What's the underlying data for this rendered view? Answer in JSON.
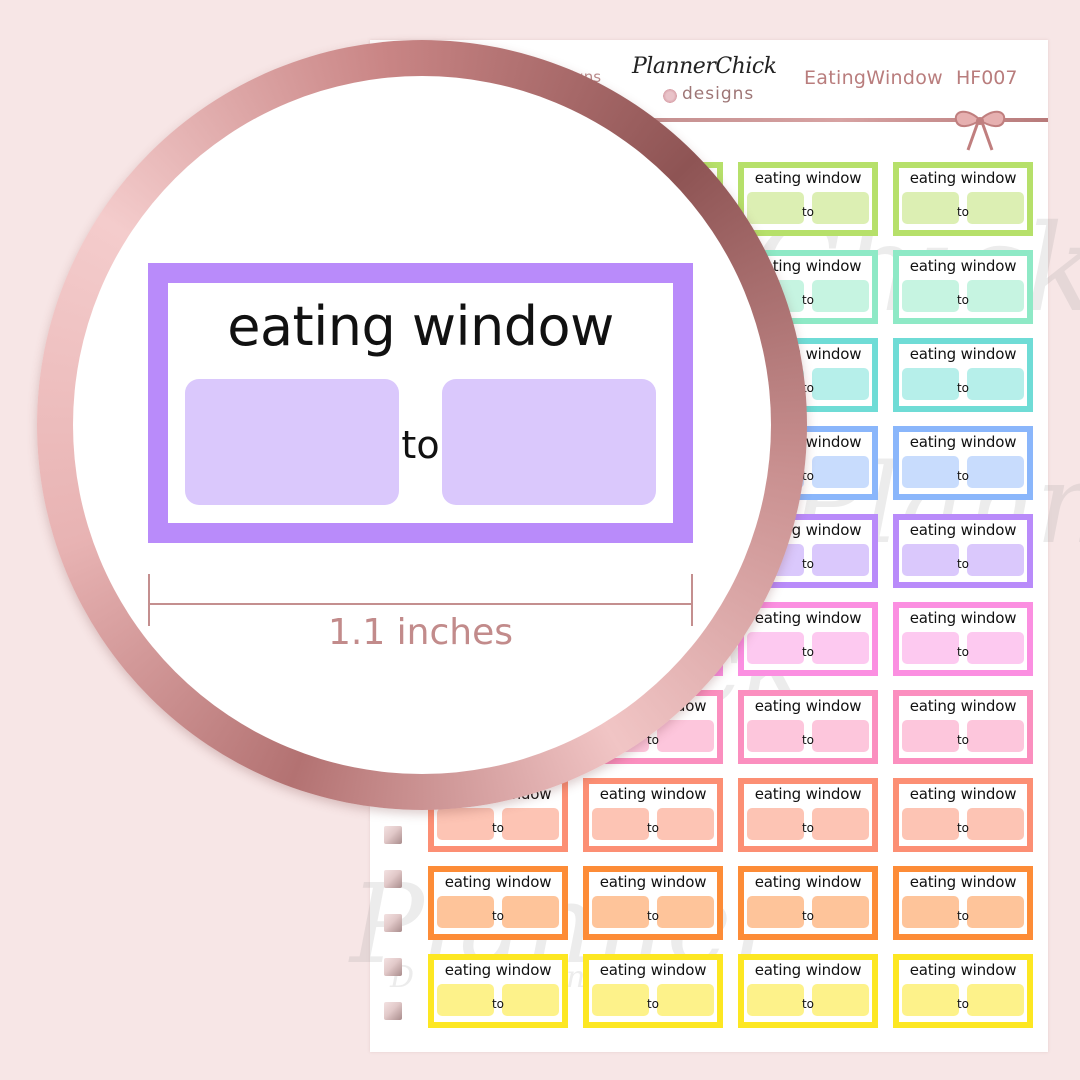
{
  "header": {
    "brand_partial": "igns",
    "brand_name": "PlannerChick",
    "brand_sub": "designs",
    "product_title": "EatingWindow",
    "product_code": "HF007"
  },
  "sticker_text": {
    "label": "eating window",
    "connector": "to"
  },
  "rows": [
    {
      "color": "green",
      "border": "#b6e06a",
      "fill": "#dcefb3"
    },
    {
      "color": "mint",
      "border": "#8ee9c6",
      "fill": "#c6f4e1"
    },
    {
      "color": "teal",
      "border": "#6fdcd6",
      "fill": "#b6efea"
    },
    {
      "color": "blue",
      "border": "#8ab6fb",
      "fill": "#c8dcfd"
    },
    {
      "color": "purple",
      "border": "#b98bfa",
      "fill": "#dac8fc"
    },
    {
      "color": "magenta",
      "border": "#fb8fe1",
      "fill": "#fdc9f0"
    },
    {
      "color": "pink",
      "border": "#fb8fbf",
      "fill": "#fdc6dc"
    },
    {
      "color": "salmon",
      "border": "#fc8f74",
      "fill": "#fdc4b4"
    },
    {
      "color": "orange",
      "border": "#fd8c37",
      "fill": "#fec49a"
    },
    {
      "color": "yellow",
      "border": "#fde722",
      "fill": "#fdf28a"
    }
  ],
  "magnifier": {
    "label": "eating window",
    "connector": "to",
    "dimension": "1.1 inches",
    "border_color": "#b98bfa",
    "fill_color": "#dac8fc"
  },
  "watermarks": [
    "Planner",
    "Chick",
    "Designs"
  ],
  "checkbox_count": 5
}
